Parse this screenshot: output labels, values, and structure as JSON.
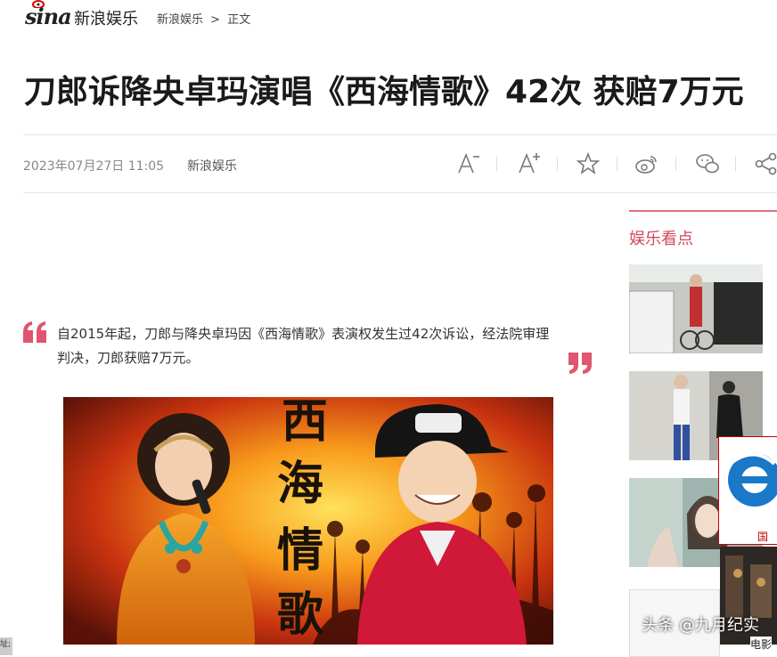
{
  "header": {
    "logo_text": "sina",
    "site_name": "新浪娱乐",
    "breadcrumb": [
      "新浪娱乐",
      ">",
      "正文"
    ]
  },
  "article": {
    "title": "刀郎诉降央卓玛演唱《西海情歌》42次 获赔7万元",
    "date": "2023年07月27日 11:05",
    "source": "新浪娱乐",
    "summary": "自2015年起，刀郎与降央卓玛因《西海情歌》表演权发生过42次诉讼，经法院审理判决，刀郎获赔7万元。",
    "photo_text": [
      "西",
      "海",
      "情",
      "歌"
    ]
  },
  "toolbar": {
    "icons": [
      "font-decrease-icon",
      "font-increase-icon",
      "star-icon",
      "weibo-icon",
      "wechat-icon",
      "share-icon"
    ]
  },
  "sidebar": {
    "title": "娱乐看点",
    "ad_label": "国外",
    "ad2_label": "电影"
  },
  "watermark": "头条 @九月纪实",
  "corner_tag": "址;",
  "colors": {
    "accent": "#d04a5c",
    "quote": "#e05570"
  }
}
